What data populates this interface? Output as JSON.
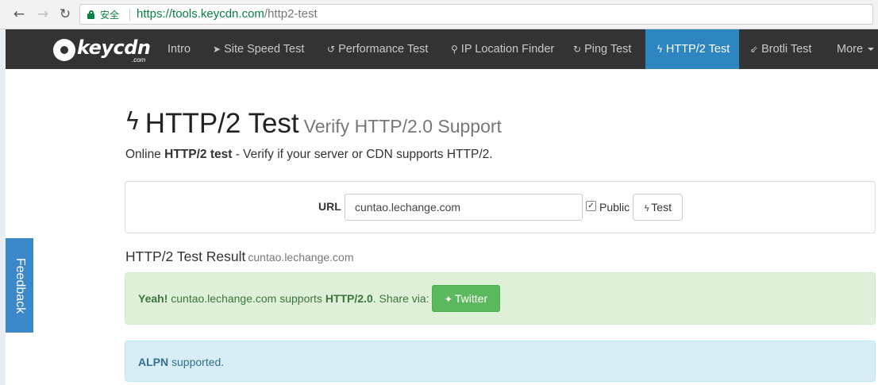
{
  "browser": {
    "back_icon": "arrow-left-icon",
    "forward_icon": "arrow-right-icon",
    "reload_icon": "reload-icon",
    "secure_label": "安全",
    "url_host": "https://tools.keycdn.com",
    "url_path": "/http2-test"
  },
  "navbar": {
    "logo_text": "keycdn",
    "logo_sub": ".com",
    "items": [
      {
        "label": "Intro",
        "icon": ""
      },
      {
        "label": "Site Speed Test",
        "icon": "rocket-icon"
      },
      {
        "label": "Performance Test",
        "icon": "history-icon"
      },
      {
        "label": "IP Location Finder",
        "icon": "map-marker-icon"
      },
      {
        "label": "Ping Test",
        "icon": "refresh-icon"
      },
      {
        "label": "HTTP/2 Test",
        "icon": "bolt-icon",
        "active": true
      },
      {
        "label": "Brotli Test",
        "icon": "compress-icon"
      },
      {
        "label": "More",
        "icon": "caret-down-icon"
      }
    ],
    "active_color": "#2e86c1"
  },
  "feedback": {
    "label": "Feedback"
  },
  "page": {
    "title": "HTTP/2 Test",
    "subtitle": "Verify HTTP/2.0 Support",
    "lead_prefix": "Online ",
    "lead_bold": "HTTP/2 test",
    "lead_suffix": " - Verify if your server or CDN supports HTTP/2."
  },
  "form": {
    "url_label": "URL",
    "url_value": "cuntao.lechange.com",
    "public_checked": true,
    "public_label": "Public",
    "test_label": "Test"
  },
  "result": {
    "heading": "HTTP/2 Test Result",
    "domain": "cuntao.lechange.com",
    "success_yeah": "Yeah!",
    "success_mid": " cuntao.lechange.com supports ",
    "success_proto": "HTTP/2.0",
    "success_share": ". Share via:",
    "twitter_label": "Twitter",
    "alpn_bold": "ALPN",
    "alpn_text": " supported."
  }
}
